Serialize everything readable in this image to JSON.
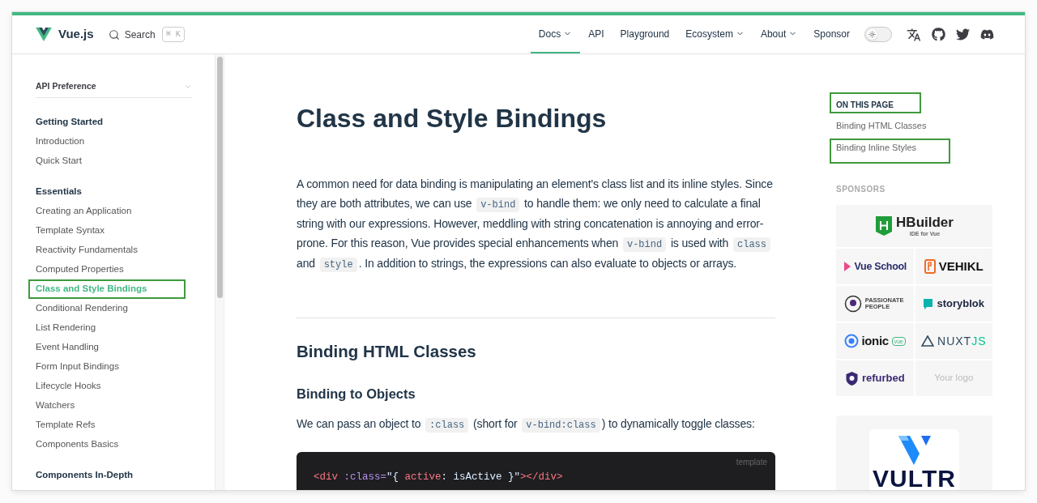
{
  "navbar": {
    "brand": "Vue.js",
    "search": {
      "label": "Search",
      "shortcut": "⌘ K"
    },
    "links": [
      {
        "label": "Docs",
        "dropdown": true,
        "selected": true
      },
      {
        "label": "API",
        "dropdown": false,
        "selected": false
      },
      {
        "label": "Playground",
        "dropdown": false,
        "selected": false
      },
      {
        "label": "Ecosystem",
        "dropdown": true,
        "selected": false
      },
      {
        "label": "About",
        "dropdown": true,
        "selected": false
      },
      {
        "label": "Sponsor",
        "dropdown": false,
        "selected": false
      }
    ],
    "theme_toggle": {
      "on": false
    }
  },
  "sidebar": {
    "preference": "API Preference",
    "groups": [
      {
        "title": "Getting Started",
        "items": [
          {
            "label": "Introduction",
            "selected": false,
            "annotated": false
          },
          {
            "label": "Quick Start",
            "selected": false,
            "annotated": false
          }
        ]
      },
      {
        "title": "Essentials",
        "items": [
          {
            "label": "Creating an Application",
            "selected": false,
            "annotated": false
          },
          {
            "label": "Template Syntax",
            "selected": false,
            "annotated": false
          },
          {
            "label": "Reactivity Fundamentals",
            "selected": false,
            "annotated": false
          },
          {
            "label": "Computed Properties",
            "selected": false,
            "annotated": false
          },
          {
            "label": "Class and Style Bindings",
            "selected": true,
            "annotated": true
          },
          {
            "label": "Conditional Rendering",
            "selected": false,
            "annotated": false
          },
          {
            "label": "List Rendering",
            "selected": false,
            "annotated": false
          },
          {
            "label": "Event Handling",
            "selected": false,
            "annotated": false
          },
          {
            "label": "Form Input Bindings",
            "selected": false,
            "annotated": false
          },
          {
            "label": "Lifecycle Hooks",
            "selected": false,
            "annotated": false
          },
          {
            "label": "Watchers",
            "selected": false,
            "annotated": false
          },
          {
            "label": "Template Refs",
            "selected": false,
            "annotated": false
          },
          {
            "label": "Components Basics",
            "selected": false,
            "annotated": false
          }
        ]
      },
      {
        "title": "Components In-Depth"
      }
    ]
  },
  "main": {
    "title": "Class and Style Bindings",
    "intro": [
      {
        "kind": "text",
        "text": "A common need for data binding is manipulating an element's class list and its inline styles. Since they are both attributes, we can use "
      },
      {
        "kind": "code",
        "text": "v-bind"
      },
      {
        "kind": "text",
        "text": " to handle them: we only need to calculate a final string with our expressions. However, meddling with string concatenation is annoying and error-prone. For this reason, Vue provides special enhancements when "
      },
      {
        "kind": "code",
        "text": "v-bind"
      },
      {
        "kind": "text",
        "text": " is used with "
      },
      {
        "kind": "code",
        "text": "class"
      },
      {
        "kind": "text",
        "text": " and "
      },
      {
        "kind": "code",
        "text": "style"
      },
      {
        "kind": "text",
        "text": ". In addition to strings, the expressions can also evaluate to objects or arrays."
      }
    ],
    "section_title": "Binding HTML Classes",
    "subsection_title": "Binding to Objects",
    "paragraph": [
      {
        "kind": "text",
        "text": "We can pass an object to "
      },
      {
        "kind": "code",
        "text": ":class"
      },
      {
        "kind": "text",
        "text": " (short for "
      },
      {
        "kind": "code",
        "text": "v-bind:class"
      },
      {
        "kind": "text",
        "text": ") to dynamically toggle classes:"
      }
    ],
    "code_block": {
      "language": "template",
      "tokens": [
        {
          "text": "<div",
          "color": "#f97583"
        },
        {
          "text": " :class=",
          "color": "#b392f0"
        },
        {
          "text": "\"{ ",
          "color": "#dbedff"
        },
        {
          "text": "active",
          "color": "#f97583"
        },
        {
          "text": ": isActive }\"",
          "color": "#dbedff"
        },
        {
          "text": "></div>",
          "color": "#f97583"
        }
      ]
    }
  },
  "aside": {
    "toc_title": "ON THIS PAGE",
    "toc_title_annotated": true,
    "toc": [
      {
        "label": "Binding HTML Classes",
        "annotated": false
      },
      {
        "label": "Binding Inline Styles",
        "annotated": true
      }
    ],
    "sponsors_title": "SPONSORS",
    "sponsors": [
      {
        "kind": "hbuilder",
        "name": "HBuilder",
        "tagline": "IDE for Vue"
      },
      {
        "kind": "vueschool",
        "name": "Vue School"
      },
      {
        "kind": "vehikl",
        "name": "VEHIKL"
      },
      {
        "kind": "passionate",
        "name": "PASSIONATE PEOPLE"
      },
      {
        "kind": "storyblok",
        "name": "storyblok"
      },
      {
        "kind": "ionic",
        "name": "ionic",
        "tag": "vue"
      },
      {
        "kind": "nuxt",
        "name": "NUXT",
        "suffix": "JS"
      },
      {
        "kind": "refurbed",
        "name": "refurbed"
      },
      {
        "kind": "placeholder",
        "name": "Your logo"
      }
    ],
    "featured_sponsor": "VULTR"
  }
}
